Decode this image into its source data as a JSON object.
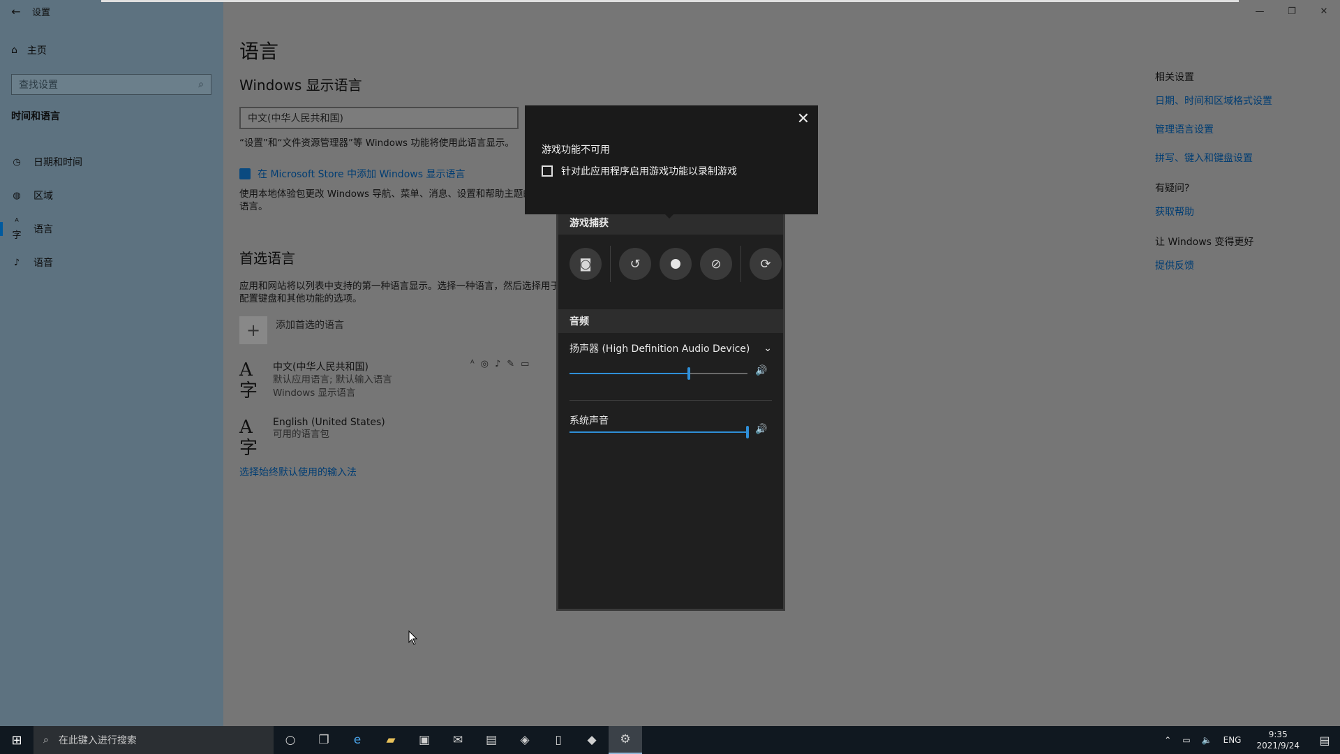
{
  "window": {
    "app_title": "设置",
    "back_glyph": "←",
    "controls": [
      "—",
      "❐",
      "✕"
    ]
  },
  "sidebar": {
    "home_label": "主页",
    "search_placeholder": "查找设置",
    "section_title": "时间和语言",
    "items": [
      {
        "label": "日期和时间",
        "icon": "calendar-clock-icon",
        "glyph": "◷",
        "active": false
      },
      {
        "label": "区域",
        "icon": "globe-icon",
        "glyph": "◍",
        "active": false
      },
      {
        "label": "语言",
        "icon": "language-icon",
        "glyph": "A字",
        "active": true
      },
      {
        "label": "语音",
        "icon": "microphone-icon",
        "glyph": "🎙",
        "active": false
      }
    ]
  },
  "main": {
    "title": "语言",
    "display_lang_heading": "Windows 显示语言",
    "display_lang_value": "中文(中华人民共和国)",
    "display_lang_note": "“设置”和“文件资源管理器”等 Windows 功能将使用此语言显示。",
    "store_link": "在 Microsoft Store 中添加 Windows 显示语言",
    "local_experience_desc": "使用本地体验包更改 Windows 导航、菜单、消息、设置和帮助主题的语言。",
    "preferred_heading": "首选语言",
    "preferred_desc": "应用和网站将以列表中支持的第一种语言显示。选择一种语言，然后选择用于配置键盘和其他功能的选项。",
    "add_language": "添加首选的语言",
    "languages": [
      {
        "name": "中文(中华人民共和国)",
        "sub1": "默认应用语言; 默认输入语言",
        "sub2": "Windows 显示语言"
      },
      {
        "name": "English (United States)",
        "sub1": "可用的语言包",
        "sub2": ""
      }
    ],
    "input_method_link": "选择始终默认使用的输入法"
  },
  "related": {
    "title": "相关设置",
    "links": [
      "日期、时间和区域格式设置",
      "管理语言设置",
      "拼写、键入和键盘设置"
    ],
    "help_title": "有疑问?",
    "help_link": "获取帮助",
    "feedback_title": "让 Windows 变得更好",
    "feedback_link": "提供反馈"
  },
  "gamebar": {
    "popup_title": "游戏功能不可用",
    "popup_checkbox": "针对此应用程序启用游戏功能以录制游戏",
    "popup_checked": false,
    "ghost_time": "9:35",
    "capture_heading": "游戏捕获",
    "audio_heading": "音频",
    "device_label": "扬声器 (High Definition Audio Device)",
    "system_sound_label": "系统声音",
    "speaker_volume": 0.67,
    "system_volume": 1.0
  },
  "taskbar": {
    "search_placeholder": "在此键入进行搜索",
    "lang": "ENG",
    "time": "9:35",
    "date": "2021/9/24"
  },
  "colors": {
    "accent": "#2f8fd8",
    "link": "#003d73",
    "sidebar_bg": "#5d7280"
  }
}
